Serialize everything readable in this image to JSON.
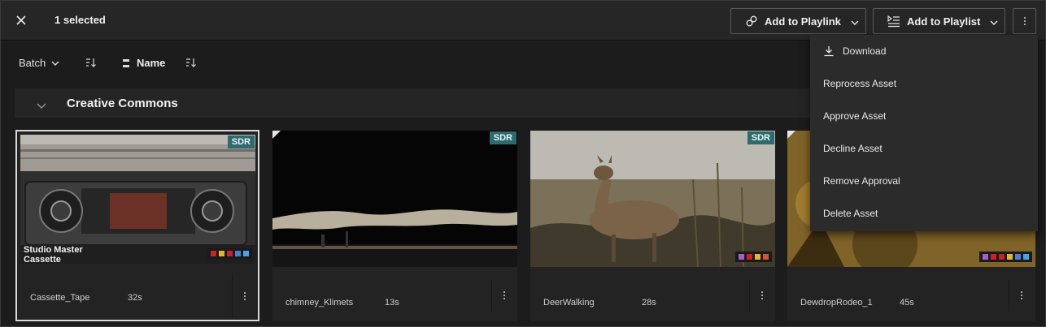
{
  "topbar": {
    "selected_text": "1 selected",
    "add_to_playlink": "Add to Playlink",
    "add_to_playlist": "Add to Playlist"
  },
  "toolbar": {
    "batch_label": "Batch",
    "sort_field": "Name"
  },
  "group": {
    "title": "Creative Commons"
  },
  "assets": [
    {
      "name": "Cassette_Tape",
      "duration": "32s",
      "badge": "SDR",
      "overlay_text": "Studio Master Cassette",
      "swatches": [
        "#c8232a",
        "#e2b53a",
        "#c8232a",
        "#4a7fd1",
        "#4aa2e6"
      ],
      "selected": true
    },
    {
      "name": "chimney_Klimets",
      "duration": "13s",
      "badge": "SDR",
      "swatches": [],
      "selected": false
    },
    {
      "name": "DeerWalking",
      "duration": "28s",
      "badge": "SDR",
      "swatches": [
        "#a260c8",
        "#c8232a",
        "#e2b53a",
        "#d7552a"
      ],
      "selected": false
    },
    {
      "name": "DewdropRodeo_1",
      "duration": "45s",
      "badge": "",
      "swatches": [
        "#a260c8",
        "#c8232a",
        "#c8232a",
        "#e2b53a",
        "#4a7fd1",
        "#4aa2e6"
      ],
      "selected": false
    }
  ],
  "menu": {
    "items": [
      "Download",
      "Reprocess Asset",
      "Approve Asset",
      "Decline Asset",
      "Remove Approval",
      "Delete Asset"
    ]
  }
}
